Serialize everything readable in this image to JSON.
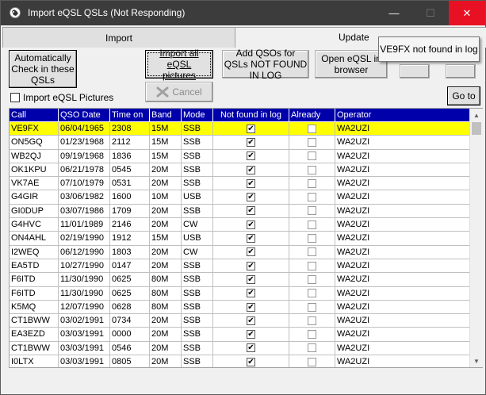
{
  "window": {
    "title": "Import eQSL QSLs (Not Responding)",
    "minimize_symbol": "—",
    "maximize_symbol": "☐",
    "close_symbol": "✕"
  },
  "tabs": [
    {
      "label": "Import"
    },
    {
      "label": "Update"
    }
  ],
  "buttons": {
    "auto_check": "Automatically Check in these QSLs",
    "import_pictures": "Import all eQSL pictures",
    "cancel": "Cancel",
    "add_qsos": "Add QSOs for QSLs NOT FOUND IN LOG",
    "open_eqsl": "Open eQSL in browser",
    "goto": "Go to"
  },
  "tooltip": "VE9FX not found in log",
  "checkbox": {
    "label": "Import eQSL Pictures",
    "checked": false
  },
  "grid": {
    "columns": [
      "Call",
      "QSO Date",
      "Time on",
      "Band",
      "Mode",
      "Not found in log",
      "Already",
      "Operator"
    ],
    "rows": [
      {
        "call": "VE9FX",
        "date": "06/04/1965",
        "time": "2308",
        "band": "15M",
        "mode": "SSB",
        "not_found": true,
        "already": false,
        "operator": "WA2UZI",
        "selected": true
      },
      {
        "call": "ON5GQ",
        "date": "01/23/1968",
        "time": "2112",
        "band": "15M",
        "mode": "SSB",
        "not_found": true,
        "already": false,
        "operator": "WA2UZI"
      },
      {
        "call": "WB2QJ",
        "date": "09/19/1968",
        "time": "1836",
        "band": "15M",
        "mode": "SSB",
        "not_found": true,
        "already": false,
        "operator": "WA2UZI"
      },
      {
        "call": "OK1KPU",
        "date": "06/21/1978",
        "time": "0545",
        "band": "20M",
        "mode": "SSB",
        "not_found": true,
        "already": false,
        "operator": "WA2UZI"
      },
      {
        "call": "VK7AE",
        "date": "07/10/1979",
        "time": "0531",
        "band": "20M",
        "mode": "SSB",
        "not_found": true,
        "already": false,
        "operator": "WA2UZI"
      },
      {
        "call": "G4GIR",
        "date": "03/06/1982",
        "time": "1600",
        "band": "10M",
        "mode": "USB",
        "not_found": true,
        "already": false,
        "operator": "WA2UZI"
      },
      {
        "call": "GI0DUP",
        "date": "03/07/1986",
        "time": "1709",
        "band": "20M",
        "mode": "SSB",
        "not_found": true,
        "already": false,
        "operator": "WA2UZI"
      },
      {
        "call": "G4HVC",
        "date": "11/01/1989",
        "time": "2146",
        "band": "20M",
        "mode": "CW",
        "not_found": true,
        "already": false,
        "operator": "WA2UZI"
      },
      {
        "call": "ON4AHL",
        "date": "02/19/1990",
        "time": "1912",
        "band": "15M",
        "mode": "USB",
        "not_found": true,
        "already": false,
        "operator": "WA2UZI"
      },
      {
        "call": "I2WEQ",
        "date": "06/12/1990",
        "time": "1803",
        "band": "20M",
        "mode": "CW",
        "not_found": true,
        "already": false,
        "operator": "WA2UZI"
      },
      {
        "call": "EA5TD",
        "date": "10/27/1990",
        "time": "0147",
        "band": "20M",
        "mode": "SSB",
        "not_found": true,
        "already": false,
        "operator": "WA2UZI"
      },
      {
        "call": "F6ITD",
        "date": "11/30/1990",
        "time": "0625",
        "band": "80M",
        "mode": "SSB",
        "not_found": true,
        "already": false,
        "operator": "WA2UZI"
      },
      {
        "call": "F6ITD",
        "date": "11/30/1990",
        "time": "0625",
        "band": "80M",
        "mode": "SSB",
        "not_found": true,
        "already": false,
        "operator": "WA2UZI"
      },
      {
        "call": "K5MQ",
        "date": "12/07/1990",
        "time": "0628",
        "band": "80M",
        "mode": "SSB",
        "not_found": true,
        "already": false,
        "operator": "WA2UZI"
      },
      {
        "call": "CT1BWW",
        "date": "03/02/1991",
        "time": "0734",
        "band": "20M",
        "mode": "SSB",
        "not_found": true,
        "already": false,
        "operator": "WA2UZI"
      },
      {
        "call": "EA3EZD",
        "date": "03/03/1991",
        "time": "0000",
        "band": "20M",
        "mode": "SSB",
        "not_found": true,
        "already": false,
        "operator": "WA2UZI"
      },
      {
        "call": "CT1BWW",
        "date": "03/03/1991",
        "time": "0546",
        "band": "20M",
        "mode": "SSB",
        "not_found": true,
        "already": false,
        "operator": "WA2UZI"
      },
      {
        "call": "I0LTX",
        "date": "03/03/1991",
        "time": "0805",
        "band": "20M",
        "mode": "SSB",
        "not_found": true,
        "already": false,
        "operator": "WA2UZI"
      }
    ]
  },
  "colors": {
    "header_bg": "#0000aa",
    "selected_row": "#ffff00",
    "close_button": "#e81123"
  }
}
